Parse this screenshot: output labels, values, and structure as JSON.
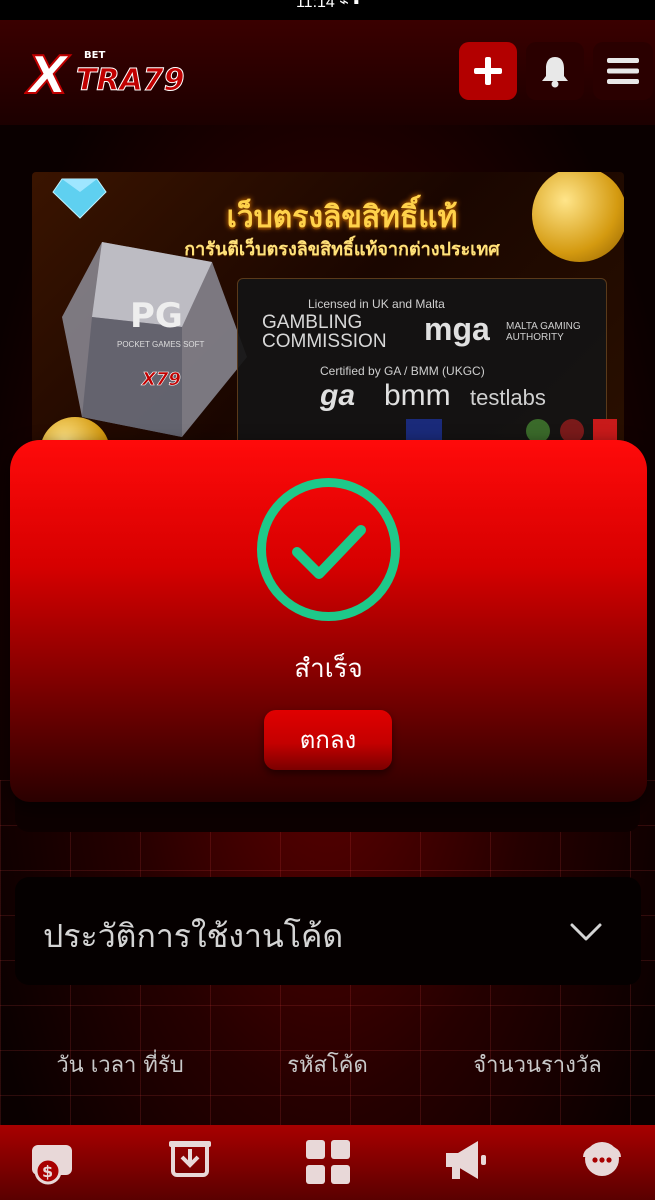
{
  "status_bar": {
    "text": "11:14 ⌁ ▪"
  },
  "header": {
    "logo_text": "XTRA79",
    "logo_small": "BET",
    "add_icon": "plus-icon",
    "bell_icon": "bell-icon",
    "menu_icon": "hamburger-menu-icon"
  },
  "banner": {
    "headline": "เว็บตรงลิขสิทธิ์แท้",
    "subheadline": "การันตีเว็บตรงลิขสิทธิ์แท้จากต่างประเทศ",
    "licensed": "Licensed in UK and Malta",
    "gambling_commission": "GAMBLING COMMISSION",
    "mga": "mga",
    "mga_sub": "MALTA GAMING AUTHORITY",
    "certified": "Certified by GA / BMM (UKGC)",
    "ga": "ga",
    "bmm": "bmm",
    "testlabs": "testlabs",
    "pg_text": "PG",
    "pocket_games": "POCKET GAMES SOFT"
  },
  "modal": {
    "icon": "check-circle-icon",
    "accent_color": "#1ec98a",
    "message": "สำเร็จ",
    "ok_label": "ตกลง"
  },
  "history": {
    "title": "ประวัติการใช้งานโค้ด",
    "toggle_icon": "chevron-down-icon",
    "columns": [
      "วัน เวลา ที่รับ",
      "รหัสโค้ด",
      "จำนวนรางวัล"
    ]
  },
  "bottom_nav": [
    {
      "icon": "wallet-dollar-icon"
    },
    {
      "icon": "deposit-download-icon"
    },
    {
      "icon": "grid-apps-icon"
    },
    {
      "icon": "megaphone-icon"
    },
    {
      "icon": "chat-support-icon"
    }
  ]
}
